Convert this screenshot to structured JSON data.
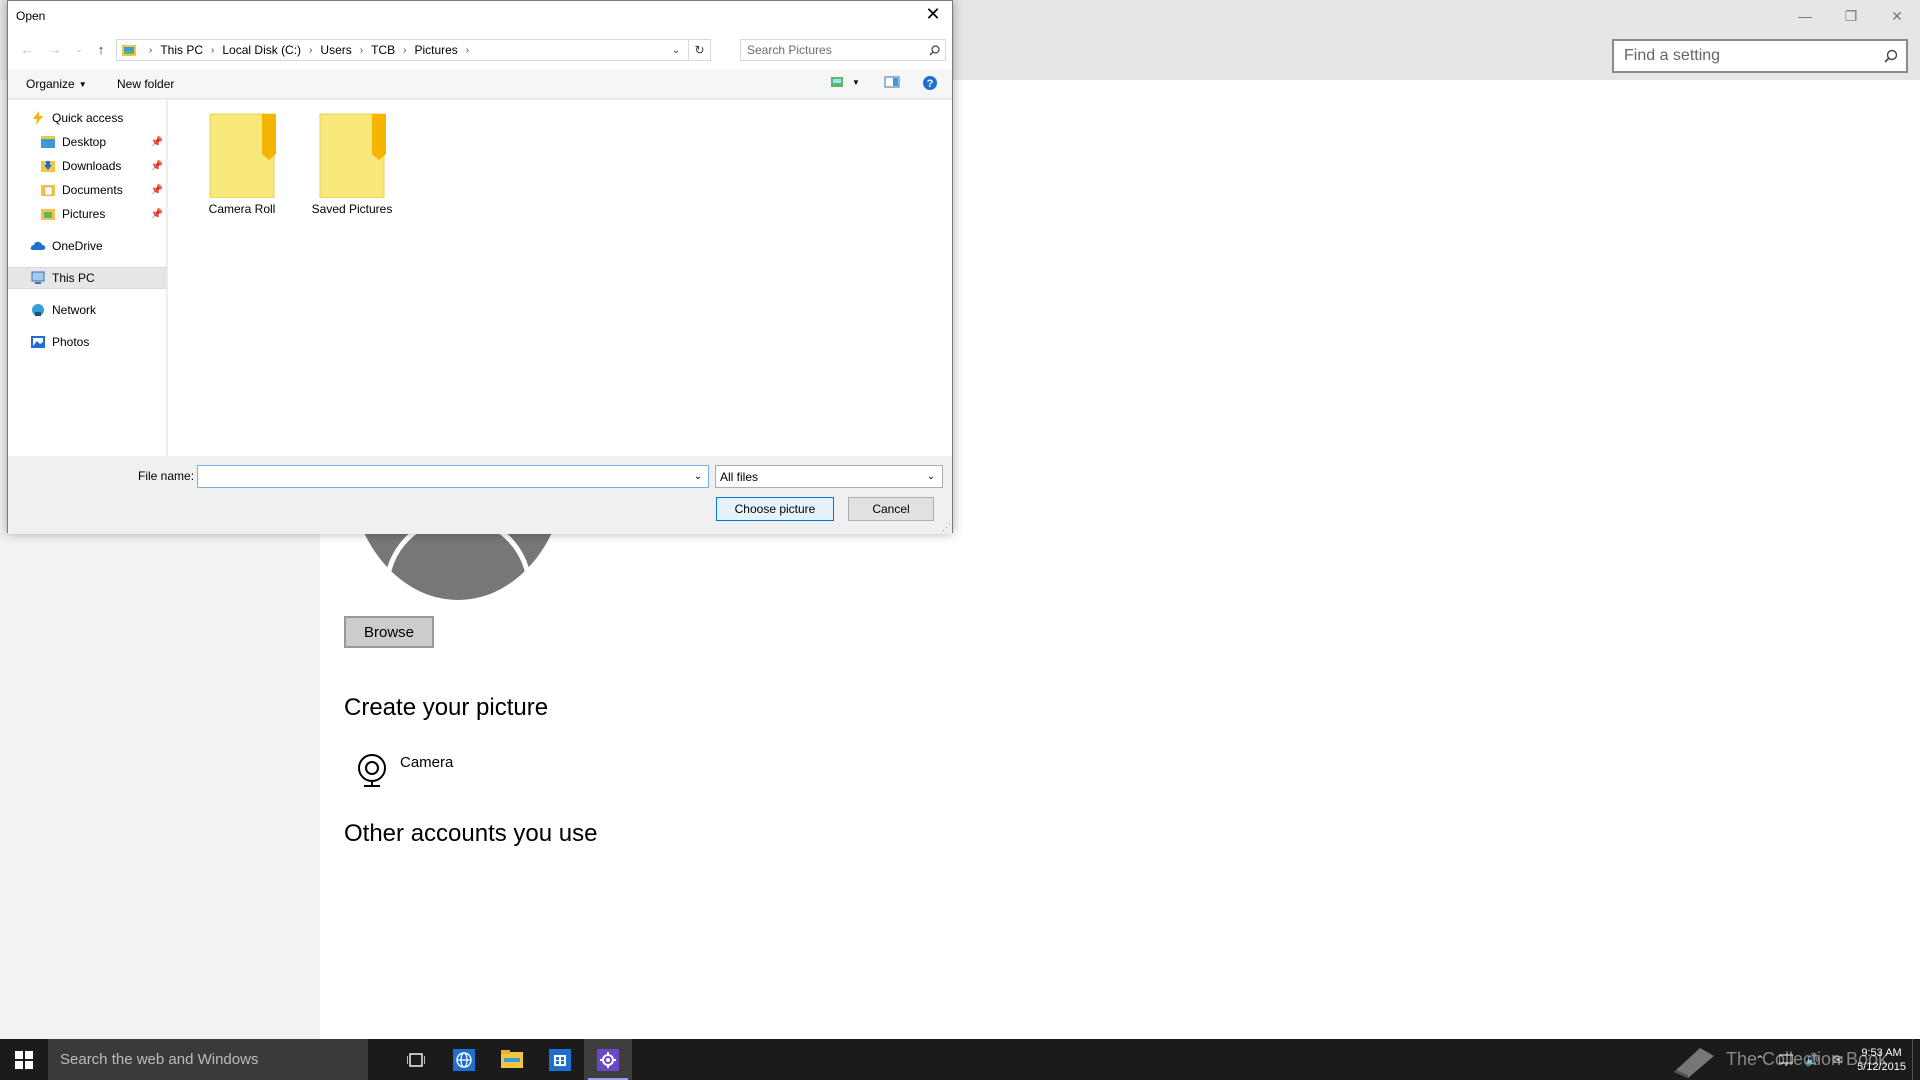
{
  "settings": {
    "search_placeholder": "Find a setting",
    "browse_label": "Browse",
    "create_picture_title": "Create your picture",
    "camera_label": "Camera",
    "other_accounts_title": "Other accounts you use",
    "window_controls": [
      "minimize-icon",
      "restore-icon",
      "close-icon"
    ]
  },
  "dialog": {
    "title": "Open",
    "breadcrumb": [
      "This PC",
      "Local Disk (C:)",
      "Users",
      "TCB",
      "Pictures"
    ],
    "search_placeholder": "Search Pictures",
    "toolbar": {
      "organize_label": "Organize",
      "new_folder_label": "New folder"
    },
    "nav_items": [
      {
        "label": "Quick access",
        "icon": "lightning-icon"
      },
      {
        "label": "Desktop",
        "icon": "desktop-icon",
        "pinned": true
      },
      {
        "label": "Downloads",
        "icon": "downloads-icon",
        "pinned": true
      },
      {
        "label": "Documents",
        "icon": "documents-icon",
        "pinned": true
      },
      {
        "label": "Pictures",
        "icon": "pictures-icon",
        "pinned": true
      },
      {
        "label": "OneDrive",
        "icon": "cloud-icon"
      },
      {
        "label": "This PC",
        "icon": "computer-icon",
        "selected": true
      },
      {
        "label": "Network",
        "icon": "network-icon"
      },
      {
        "label": "Photos",
        "icon": "photos-icon"
      }
    ],
    "folders": [
      {
        "label": "Camera Roll"
      },
      {
        "label": "Saved Pictures"
      }
    ],
    "file_name_label": "File name:",
    "file_name_value": "",
    "file_type_value": "All files",
    "choose_label": "Choose picture",
    "cancel_label": "Cancel"
  },
  "taskbar": {
    "search_placeholder": "Search the web and Windows",
    "apps": [
      "task-view-icon",
      "ie-icon",
      "file-explorer-icon",
      "store-icon",
      "settings-icon"
    ],
    "time": "9:53 AM",
    "date": "5/12/2015",
    "watermark": "The Collection Book"
  },
  "colors": {
    "accent": "#0078d7",
    "folder_yellow": "#f8e87a",
    "folder_tab": "#f4b400"
  }
}
